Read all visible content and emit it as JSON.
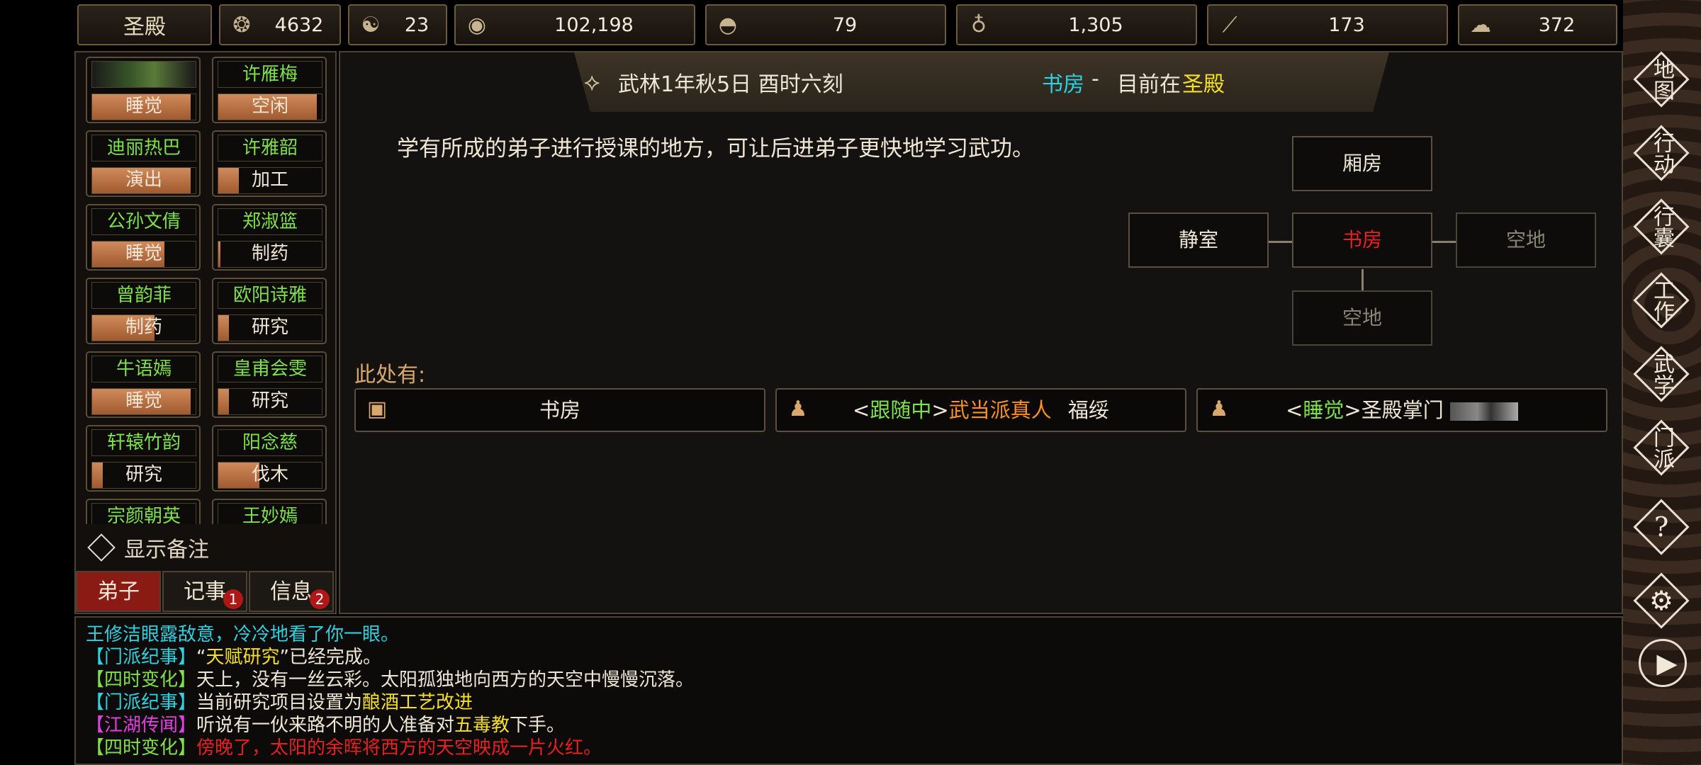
{
  "topbar": {
    "location": "圣殿",
    "resources": [
      {
        "icon": "silver-icon",
        "value": "4632"
      },
      {
        "icon": "yin-yang-icon",
        "value": "23"
      },
      {
        "icon": "coin-icon",
        "value": "102,198"
      },
      {
        "icon": "food-bowl-icon",
        "value": "79"
      },
      {
        "icon": "wine-gourd-icon",
        "value": "1,305"
      },
      {
        "icon": "wood-icon",
        "value": "173"
      },
      {
        "icon": "ore-icon",
        "value": "372"
      }
    ]
  },
  "disciples": [
    {
      "name": "",
      "activity": "睡觉",
      "progress": 0.95
    },
    {
      "name": "许雁梅",
      "activity": "空闲",
      "progress": 0.95
    },
    {
      "name": "迪丽热巴",
      "activity": "演出",
      "progress": 0.95
    },
    {
      "name": "许雅韶",
      "activity": "加工",
      "progress": 0.2
    },
    {
      "name": "公孙文倩",
      "activity": "睡觉",
      "progress": 0.7
    },
    {
      "name": "郑淑篮",
      "activity": "制药",
      "progress": 0.02
    },
    {
      "name": "曾韵菲",
      "activity": "制药",
      "progress": 0.6
    },
    {
      "name": "欧阳诗雅",
      "activity": "研究",
      "progress": 0.1
    },
    {
      "name": "牛语嫣",
      "activity": "睡觉",
      "progress": 0.95
    },
    {
      "name": "皇甫会雯",
      "activity": "研究",
      "progress": 0.1
    },
    {
      "name": "轩辕竹韵",
      "activity": "研究",
      "progress": 0.1
    },
    {
      "name": "阳念慈",
      "activity": "伐木",
      "progress": 0.4
    },
    {
      "name": "宗颜朝英",
      "activity": "",
      "progress": 0
    },
    {
      "name": "王妙嫣",
      "activity": "",
      "progress": 0
    }
  ],
  "memo_toggle": "显示备注",
  "tabs": [
    {
      "label": "弟子",
      "badge": ""
    },
    {
      "label": "记事",
      "badge": "1"
    },
    {
      "label": "信息",
      "badge": "2"
    }
  ],
  "header": {
    "date": "武林1年秋5日 酉时六刻",
    "room": "书房",
    "sep": "-",
    "now_at_prefix": "目前在",
    "now_at": "圣殿"
  },
  "description": "学有所成的弟子进行授课的地方，可让后进弟子更快地学习武功。",
  "map": {
    "north": "厢房",
    "west": "静室",
    "center": "书房",
    "east": "空地",
    "south": "空地"
  },
  "here_label": "此处有:",
  "entities": [
    {
      "icon": "box-icon",
      "text": "书房"
    },
    {
      "icon": "person-icon",
      "status": "跟随中",
      "title": "武当派真人",
      "name": "福绥"
    },
    {
      "icon": "person-icon",
      "status": "睡觉",
      "title": "圣殿掌门",
      "name": ""
    }
  ],
  "log": [
    {
      "text": "王修洁眼露敌意，冷冷地看了你一眼。"
    },
    {
      "tag": "【门派纪事】",
      "a": "“",
      "hl": "天赋研究",
      "b": "”已经完成。"
    },
    {
      "tag": "【四时变化】",
      "a": "天上，没有一丝云彩。太阳孤独地向西方的天空中慢慢沉落。"
    },
    {
      "tag": "【门派纪事】",
      "a": "当前研究项目设置为",
      "hl": "酿酒工艺改进"
    },
    {
      "tag": "【江湖传闻】",
      "a": "听说有一伙来路不明的人准备对",
      "hl": "五毒教",
      "b": "下手。"
    },
    {
      "tag": "【四时变化】",
      "a": "傍晚了，太阳的余晖将西方的天空映成一片火红。"
    }
  ],
  "menu": [
    {
      "label": "地图",
      "icon": "map-icon"
    },
    {
      "label": "行动",
      "icon": "action-icon"
    },
    {
      "label": "行囊",
      "icon": "bag-icon"
    },
    {
      "label": "工作",
      "icon": "work-icon"
    },
    {
      "label": "武学",
      "icon": "martial-icon"
    },
    {
      "label": "门派",
      "icon": "sect-icon"
    },
    {
      "label": "?",
      "icon": "help-icon"
    },
    {
      "label": "⚙",
      "icon": "settings-icon"
    },
    {
      "label": "▶",
      "icon": "play-icon"
    }
  ],
  "colors": {
    "green": "#7ee04a",
    "cyan": "#2fd0e0",
    "yellow": "#f5e025",
    "red": "#e82020",
    "orange": "#ff9020",
    "magenta": "#e040e0"
  }
}
